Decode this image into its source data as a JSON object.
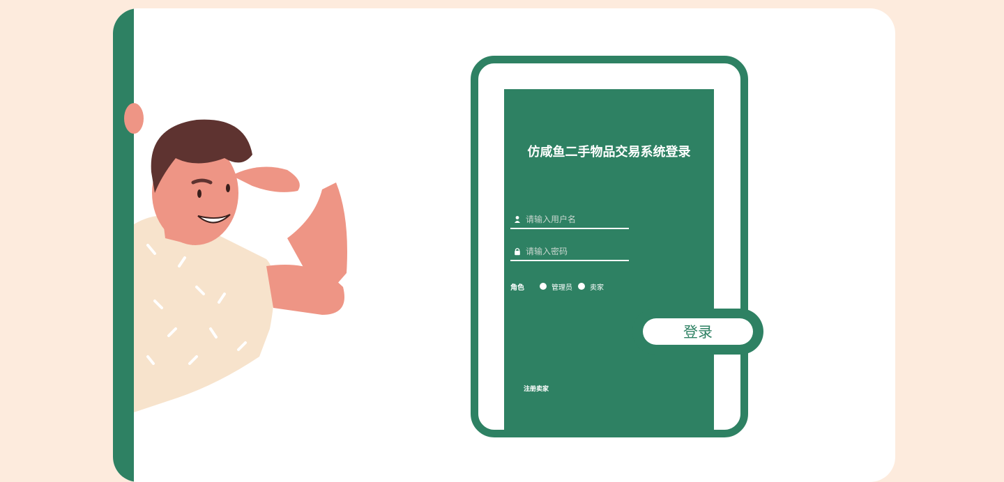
{
  "login": {
    "title": "仿咸鱼二手物品交易系统登录",
    "username_placeholder": "请输入用户名",
    "password_placeholder": "请输入密码",
    "role_label": "角色",
    "roles": [
      "管理员",
      "卖家"
    ],
    "submit_label": "登录",
    "register_label": "注册卖家"
  },
  "icons": {
    "username": "user-icon",
    "password": "lock-icon"
  },
  "colors": {
    "background": "#FDEBDD",
    "accent": "#2E8163",
    "card": "#FFFFFF"
  }
}
